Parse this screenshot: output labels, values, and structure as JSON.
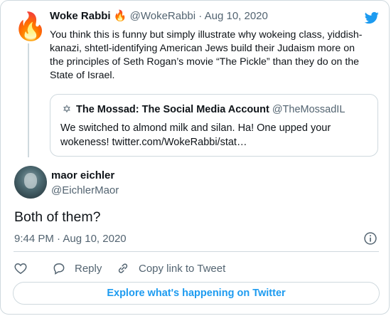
{
  "parent_tweet": {
    "avatar_emoji": "🔥",
    "author_name": "Woke Rabbi",
    "author_badge": "🔥",
    "author_handle": "@WokeRabbi",
    "separator": "·",
    "date": "Aug 10, 2020",
    "text": "You think this is funny but simply illustrate why wokeing class, yiddish-kanazi, shtetl-identifying American Jews build their Judaism more on the principles of Seth Rogan’s movie “The Pickle” than they do on the State of Israel.",
    "quoted": {
      "icon": "star-of-david-icon",
      "author_name": "The Mossad: The Social Media Account",
      "author_handle": "@TheMossadIL",
      "text": "We switched to almond milk and silan. Ha! One upped your wokeness! twitter.com/WokeRabbi/stat…"
    }
  },
  "main_tweet": {
    "author_name": "maor eichler",
    "author_handle": "@EichlerMaor",
    "text": "Both of them?",
    "time": "9:44 PM",
    "separator": "·",
    "date": "Aug 10, 2020"
  },
  "actions": {
    "reply_label": "Reply",
    "copy_label": "Copy link to Tweet"
  },
  "explore_label": "Explore what's happening on Twitter",
  "colors": {
    "accent": "#1d9bf0",
    "text": "#0f1419",
    "muted": "#536471",
    "border": "#cfd9de"
  }
}
